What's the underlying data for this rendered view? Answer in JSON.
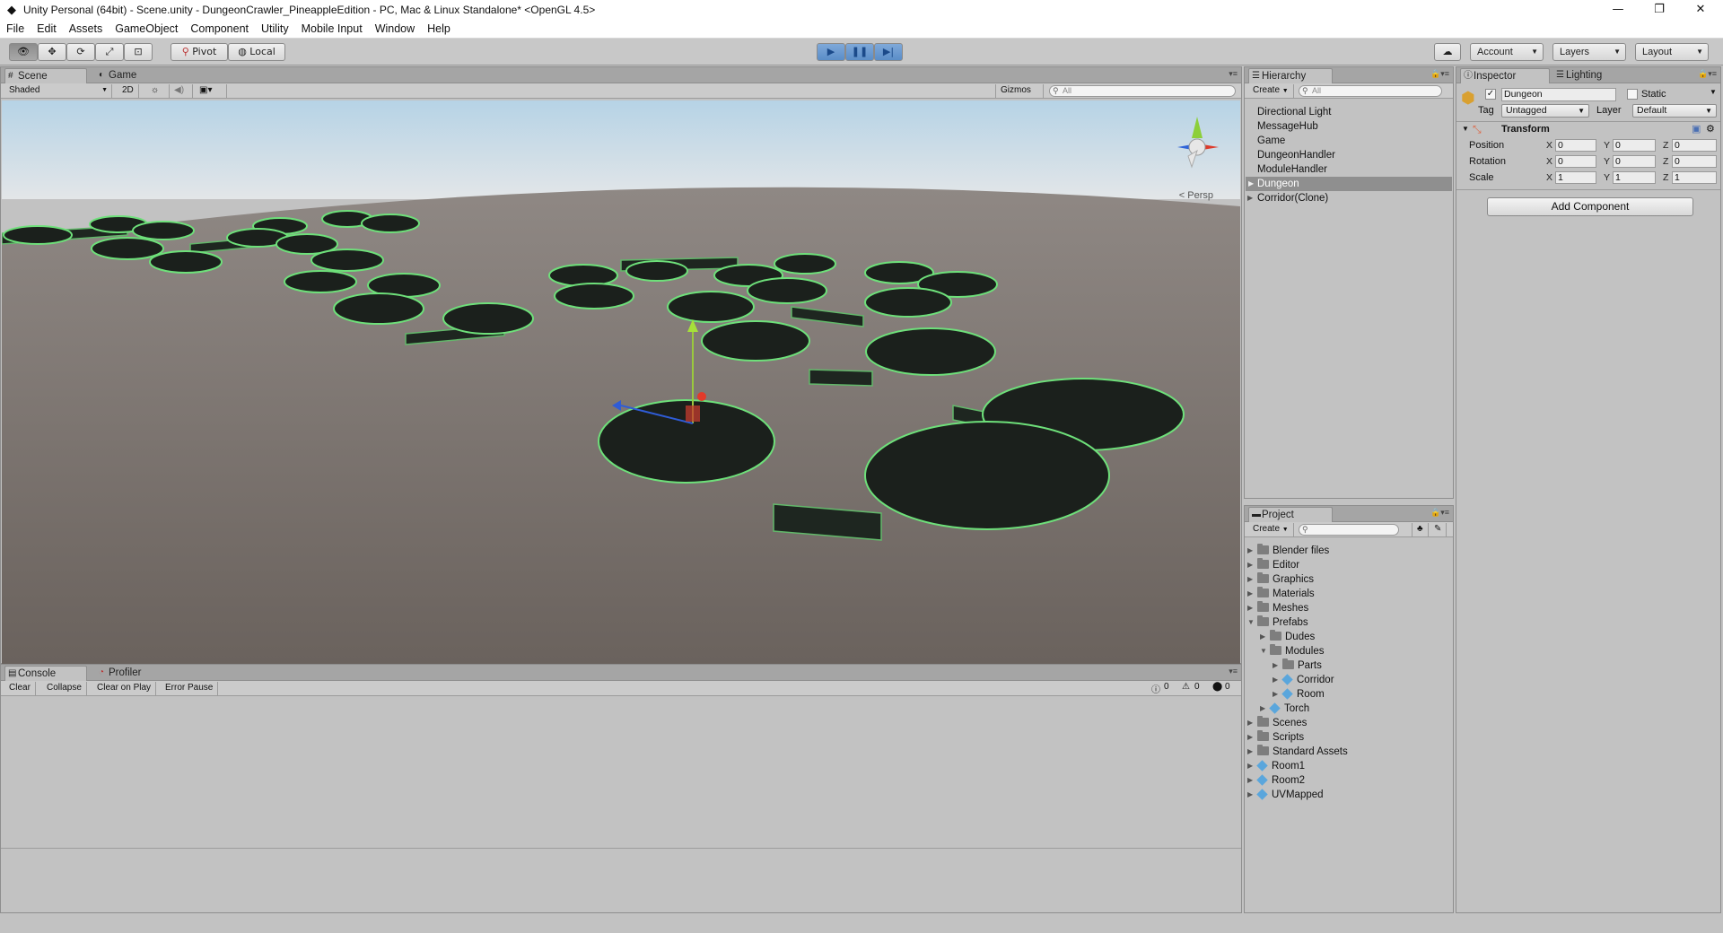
{
  "window": {
    "title": "Unity Personal (64bit) - Scene.unity - DungeonCrawler_PineappleEdition - PC, Mac & Linux Standalone* <OpenGL 4.5>",
    "minimize_glyph": "—",
    "restore_glyph": "❐",
    "close_glyph": "✕"
  },
  "menu": [
    "File",
    "Edit",
    "Assets",
    "GameObject",
    "Component",
    "Utility",
    "Mobile Input",
    "Window",
    "Help"
  ],
  "toolbar": {
    "pivot_label": "Pivot",
    "local_label": "Local",
    "account_label": "Account",
    "layers_label": "Layers",
    "layout_label": "Layout"
  },
  "scene_panel": {
    "tabs": [
      "Scene",
      "Game"
    ],
    "shading_mode": "Shaded",
    "mode_2d": "2D",
    "gizmos_label": "Gizmos",
    "search_placeholder": "All",
    "persp_label": "< Persp"
  },
  "console_panel": {
    "tabs": [
      "Console",
      "Profiler"
    ],
    "buttons": [
      "Clear",
      "Collapse",
      "Clear on Play",
      "Error Pause"
    ],
    "info_count": "0",
    "warning_count": "0",
    "error_count": "0"
  },
  "hierarchy": {
    "tab": "Hierarchy",
    "create_label": "Create",
    "search_placeholder": "All",
    "items": [
      "Directional Light",
      "MessageHub",
      "Game",
      "DungeonHandler",
      "ModuleHandler",
      "Dungeon",
      "Corridor(Clone)"
    ],
    "selected": "Dungeon"
  },
  "project": {
    "tab": "Project",
    "create_label": "Create",
    "items": [
      "Blender files",
      "Editor",
      "Graphics",
      "Materials",
      "Meshes",
      "Prefabs",
      "Dudes",
      "Modules",
      "Parts",
      "Corridor",
      "Room",
      "Torch",
      "Scenes",
      "Scripts",
      "Standard Assets",
      "Room1",
      "Room2",
      "UVMapped"
    ]
  },
  "inspector": {
    "tabs": [
      "Inspector",
      "Lighting"
    ],
    "object_name": "Dungeon",
    "static_label": "Static",
    "tag_label": "Tag",
    "tag_value": "Untagged",
    "layer_label": "Layer",
    "layer_value": "Default",
    "component_title": "Transform",
    "rows": [
      {
        "label": "Position",
        "x": "0",
        "y": "0",
        "z": "0"
      },
      {
        "label": "Rotation",
        "x": "0",
        "y": "0",
        "z": "0"
      },
      {
        "label": "Scale",
        "x": "1",
        "y": "1",
        "z": "1"
      }
    ],
    "axis_x": "X",
    "axis_y": "Y",
    "axis_z": "Z",
    "add_component_label": "Add Component"
  }
}
